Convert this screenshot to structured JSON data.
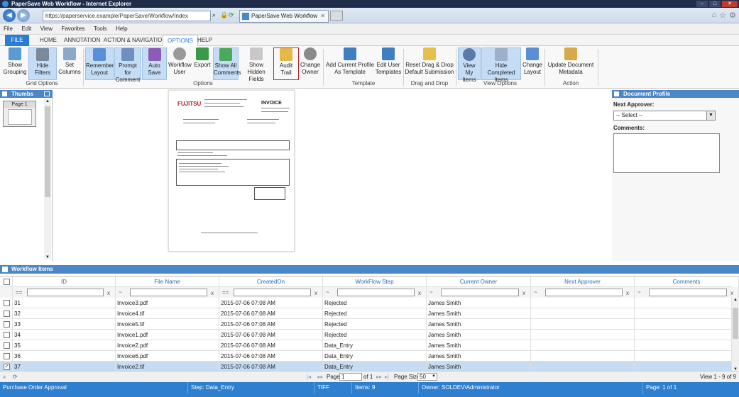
{
  "window": {
    "title": "PaperSave Web Workflow - Internet Explorer",
    "url": "https://paperservice.example/PaperSave/Workflow/Index",
    "tab_title": "PaperSave Web Workflow"
  },
  "menu": [
    "File",
    "Edit",
    "View",
    "Favorites",
    "Tools",
    "Help"
  ],
  "ribbon_tabs": {
    "file": "FILE",
    "home": "HOME",
    "annotation": "ANNOTATION",
    "action_nav": "ACTION & NAVIGATION",
    "options": "OPTIONS",
    "help": "HELP"
  },
  "ribbon": {
    "show_grouping": "Show Grouping",
    "hide_filters": "Hide Filters",
    "set_columns": "Set Columns",
    "grid_options": "Grid Options",
    "remember_layout": "Remember Layout",
    "prompt_comment": "Prompt for Comment",
    "auto_save": "Auto Save",
    "workflow_user": "Workflow User",
    "export": "Export",
    "show_all_comments": "Show All Comments",
    "show_hidden_fields": "Show Hidden Fields",
    "audit_trail": "Audit Trail",
    "change_owner": "Change Owner",
    "options_group": "Options",
    "add_profile": "Add Current Profile As Template",
    "edit_templates": "Edit User Templates",
    "template_group": "Template",
    "reset_dd": "Reset Drag & Drop Default Submission",
    "dd_group": "Drag and Drop",
    "view_my_items": "View My Items",
    "hide_completed": "Hide Completed Items",
    "change_layout": "Change Layout",
    "view_options": "View Options",
    "update_metadata": "Update Document Metadata",
    "action_group": "Action"
  },
  "thumbs": {
    "header": "Thumbs",
    "page_label": "Page 1"
  },
  "document": {
    "logo": "FUJITSU",
    "heading": "INVOICE"
  },
  "profile": {
    "header": "Document Profile",
    "next_approver_label": "Next Approver:",
    "select_value": "-- Select --",
    "comments_label": "Comments:"
  },
  "workflow": {
    "header": "Workflow Items",
    "columns": [
      "ID",
      "File Name",
      "CreatedOn",
      "WorkFlow Step",
      "Current Owner",
      "Next Approver",
      "Comments"
    ],
    "filter_ops": [
      "==",
      "~",
      "==",
      "~",
      "~",
      "~",
      "~"
    ],
    "filter_clear": "x",
    "rows": [
      {
        "checked": false,
        "id": "31",
        "file": "Invoice3.pdf",
        "created": "2015-07-06 07:08 AM",
        "step": "Rejected",
        "owner": "James Smith",
        "approver": "",
        "comments": ""
      },
      {
        "checked": false,
        "id": "32",
        "file": "Invoice4.tif",
        "created": "2015-07-06 07:08 AM",
        "step": "Rejected",
        "owner": "James Smith",
        "approver": "",
        "comments": ""
      },
      {
        "checked": false,
        "id": "33",
        "file": "Invoice5.tif",
        "created": "2015-07-06 07:08 AM",
        "step": "Rejected",
        "owner": "James Smith",
        "approver": "",
        "comments": ""
      },
      {
        "checked": false,
        "id": "34",
        "file": "Invoice1.pdf",
        "created": "2015-07-06 07:08 AM",
        "step": "Rejected",
        "owner": "James Smith",
        "approver": "",
        "comments": ""
      },
      {
        "checked": false,
        "id": "35",
        "file": "Invoice2.pdf",
        "created": "2015-07-06 07:08 AM",
        "step": "Data_Entry",
        "owner": "James Smith",
        "approver": "",
        "comments": ""
      },
      {
        "checked": false,
        "id": "36",
        "file": "Invoice6.pdf",
        "created": "2015-07-06 07:08 AM",
        "step": "Data_Entry",
        "owner": "James Smith",
        "approver": "",
        "comments": ""
      },
      {
        "checked": true,
        "id": "37",
        "file": "Invoice2.tif",
        "created": "2015-07-06 07:08 AM",
        "step": "Data_Entry",
        "owner": "James Smith",
        "approver": "",
        "comments": ""
      }
    ]
  },
  "pager": {
    "page_label": "Page",
    "page_value": "1",
    "of_label": "of 1",
    "page_size_label": "Page Size",
    "page_size_value": "50",
    "view_info": "View 1 - 9 of 9"
  },
  "status": {
    "workflow": "Purchase Order Approval",
    "step": "Step: Data_Entry",
    "type": "TIFF",
    "items": "Items: 9",
    "owner": "Owner: SOLDEV\\Administrator",
    "page": "Page: 1 of 1"
  }
}
